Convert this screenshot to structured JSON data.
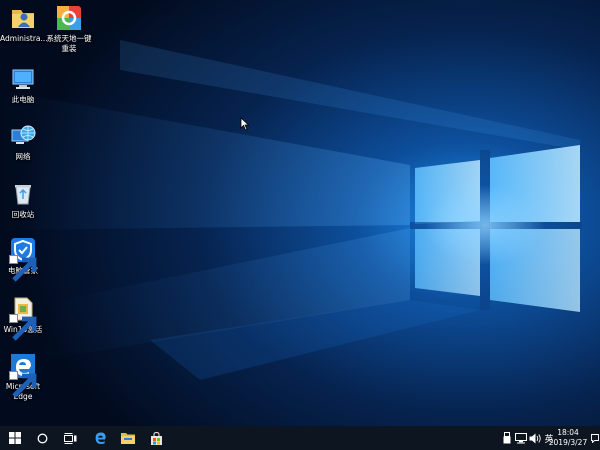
{
  "desktop": {
    "icons": [
      {
        "label": "Administra..."
      },
      {
        "label": "系统天地一键重装"
      },
      {
        "label": "此电脑"
      },
      {
        "label": "网络"
      },
      {
        "label": "回收站"
      },
      {
        "label": "电脑管家"
      },
      {
        "label": "Win10激活"
      },
      {
        "label": "Microsoft Edge"
      }
    ]
  },
  "taskbar": {
    "start": "windows-logo-icon",
    "search": "cortana-circle-icon",
    "task_view": "task-view-icon",
    "pinned": [
      "edge-icon",
      "file-explorer-icon",
      "store-icon"
    ],
    "tray": {
      "icons": [
        "usb-icon",
        "network-icon",
        "volume-icon"
      ],
      "ime_label": "英",
      "time": "18:04",
      "date": "2019/3/27"
    }
  },
  "colors": {
    "accent": "#1a8fe8",
    "taskbar_bg": "#0d1520",
    "wallpaper_dark": "#03112b"
  }
}
